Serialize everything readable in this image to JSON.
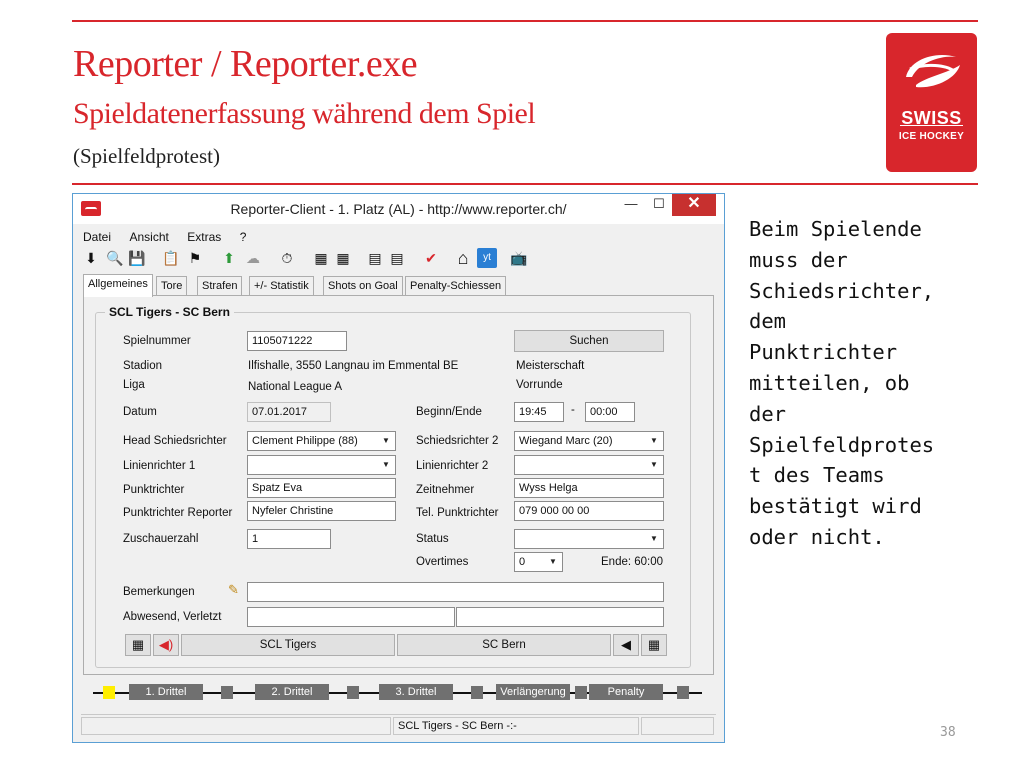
{
  "slide": {
    "title": "Reporter / Reporter.exe",
    "subtitle": "Spieldatenerfassung während dem Spiel",
    "note": "(Spielfeldprotest)",
    "side_text": "Beim Spielende\nmuss der\nSchiedsrichter,\ndem\nPunktrichter\nmitteilen, ob\nder\nSpielfeldprotes\nt des Teams\nbestätigt wird\noder nicht.",
    "page_number": "38",
    "accent_color": "#d8262c"
  },
  "logo": {
    "line1": "SWISS",
    "line2": "ICE HOCKEY",
    "icon": "swiss-ice-hockey-logo"
  },
  "window": {
    "title": "Reporter-Client  -  1. Platz (AL)  -  http://www.reporter.ch/",
    "minimize_glyph": "—",
    "maximize_glyph": "☐",
    "close_glyph": "✕"
  },
  "menu": [
    "Datei",
    "Ansicht",
    "Extras",
    "?"
  ],
  "toolbar_icons": [
    {
      "name": "download-icon",
      "glyph": "⬇"
    },
    {
      "name": "search-icon",
      "glyph": "🔍"
    },
    {
      "name": "save-icon",
      "glyph": "💾"
    },
    {
      "name": "clipboard-icon",
      "glyph": "📋"
    },
    {
      "name": "referee-icon",
      "glyph": "⚑"
    },
    {
      "name": "upload-icon",
      "glyph": "⬆"
    },
    {
      "name": "cloud-icon",
      "glyph": "☁"
    },
    {
      "name": "stopwatch-icon",
      "glyph": "⏱"
    },
    {
      "name": "players-home-icon",
      "glyph": "▦"
    },
    {
      "name": "players-away-icon",
      "glyph": "▦"
    },
    {
      "name": "lineup-home-icon",
      "glyph": "▤"
    },
    {
      "name": "lineup-away-icon",
      "glyph": "▤"
    },
    {
      "name": "check-icon",
      "glyph": "✔"
    },
    {
      "name": "home-icon",
      "glyph": "⌂"
    },
    {
      "name": "youtube-icon",
      "glyph": "yt"
    },
    {
      "name": "tv-icon",
      "glyph": "📺"
    }
  ],
  "tabs": [
    "Allgemeines",
    "Tore",
    "Strafen",
    "+/- Statistik",
    "Shots on Goal",
    "Penalty-Schiessen"
  ],
  "form": {
    "group_title": "SCL Tigers - SC Bern",
    "spielnummer_label": "Spielnummer",
    "spielnummer_value": "1105071222",
    "suchen_label": "Suchen",
    "stadion_label": "Stadion",
    "stadion_value": "Ilfishalle, 3550 Langnau im Emmental BE",
    "liga_label": "Liga",
    "liga_value": "National League A",
    "meisterschaft": "Meisterschaft",
    "vorrunde": "Vorrunde",
    "datum_label": "Datum",
    "datum_value": "07.01.2017",
    "beginn_label": "Beginn/Ende",
    "beginn_value": "19:45",
    "dash": "-",
    "ende_value": "00:00",
    "head_sr_label": "Head Schiedsrichter",
    "head_sr_value": "Clement Philippe (88)",
    "sr2_label": "Schiedsrichter 2",
    "sr2_value": "Wiegand Marc (20)",
    "lr1_label": "Linienrichter 1",
    "lr1_value": "",
    "lr2_label": "Linienrichter 2",
    "lr2_value": "",
    "punktrichter_label": "Punktrichter",
    "punktrichter_value": "Spatz Eva",
    "zeitnehmer_label": "Zeitnehmer",
    "zeitnehmer_value": "Wyss Helga",
    "pr_reporter_label": "Punktrichter Reporter",
    "pr_reporter_value": "Nyfeler Christine",
    "tel_label": "Tel. Punktrichter",
    "tel_value": "079 000 00 00",
    "zuschauer_label": "Zuschauerzahl",
    "zuschauer_value": "1",
    "status_label": "Status",
    "status_value": "",
    "overtimes_label": "Overtimes",
    "overtimes_value": "0",
    "ende_text": "Ende: 60:00",
    "bemerkungen_label": "Bemerkungen",
    "bemerkungen_value": "",
    "abwesend_label": "Abwesend, Verletzt",
    "abwesend_home": "",
    "abwesend_away": "",
    "home_team": "SCL Tigers",
    "away_team": "SC Bern"
  },
  "phases": [
    "1. Drittel",
    "2. Drittel",
    "3. Drittel",
    "Verlängerung",
    "Penalty"
  ],
  "statusbar": {
    "score": "SCL Tigers - SC Bern -:-"
  }
}
